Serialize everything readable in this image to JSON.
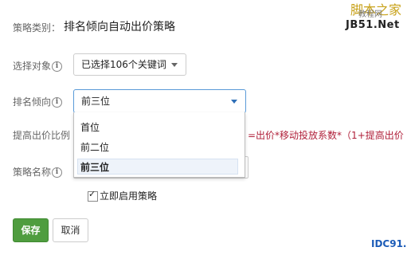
{
  "strategy_type": {
    "label": "策略类别：",
    "value": "排名倾向自动出价策略"
  },
  "select_target": {
    "label": "选择对象",
    "value": "已选择106个关键词"
  },
  "rank_preference": {
    "label": "排名倾向",
    "value": "前三位",
    "options": [
      "首位",
      "前二位",
      "前三位"
    ]
  },
  "raise_ratio": {
    "label": "提高出价比例",
    "formula": "=出价*移动投放系数*（1+提高出价"
  },
  "strategy_name": {
    "label": "策略名称"
  },
  "enable_now": {
    "label": "立即启用策略",
    "checked": true
  },
  "actions": {
    "save": "保存",
    "cancel": "取消"
  },
  "watermarks": {
    "top_right_1": "脚本之家",
    "top_right_1b": "教程网",
    "top_right_2": "JB51.Net",
    "bottom_right": "IDC91."
  },
  "info_icon_glyph": "i"
}
